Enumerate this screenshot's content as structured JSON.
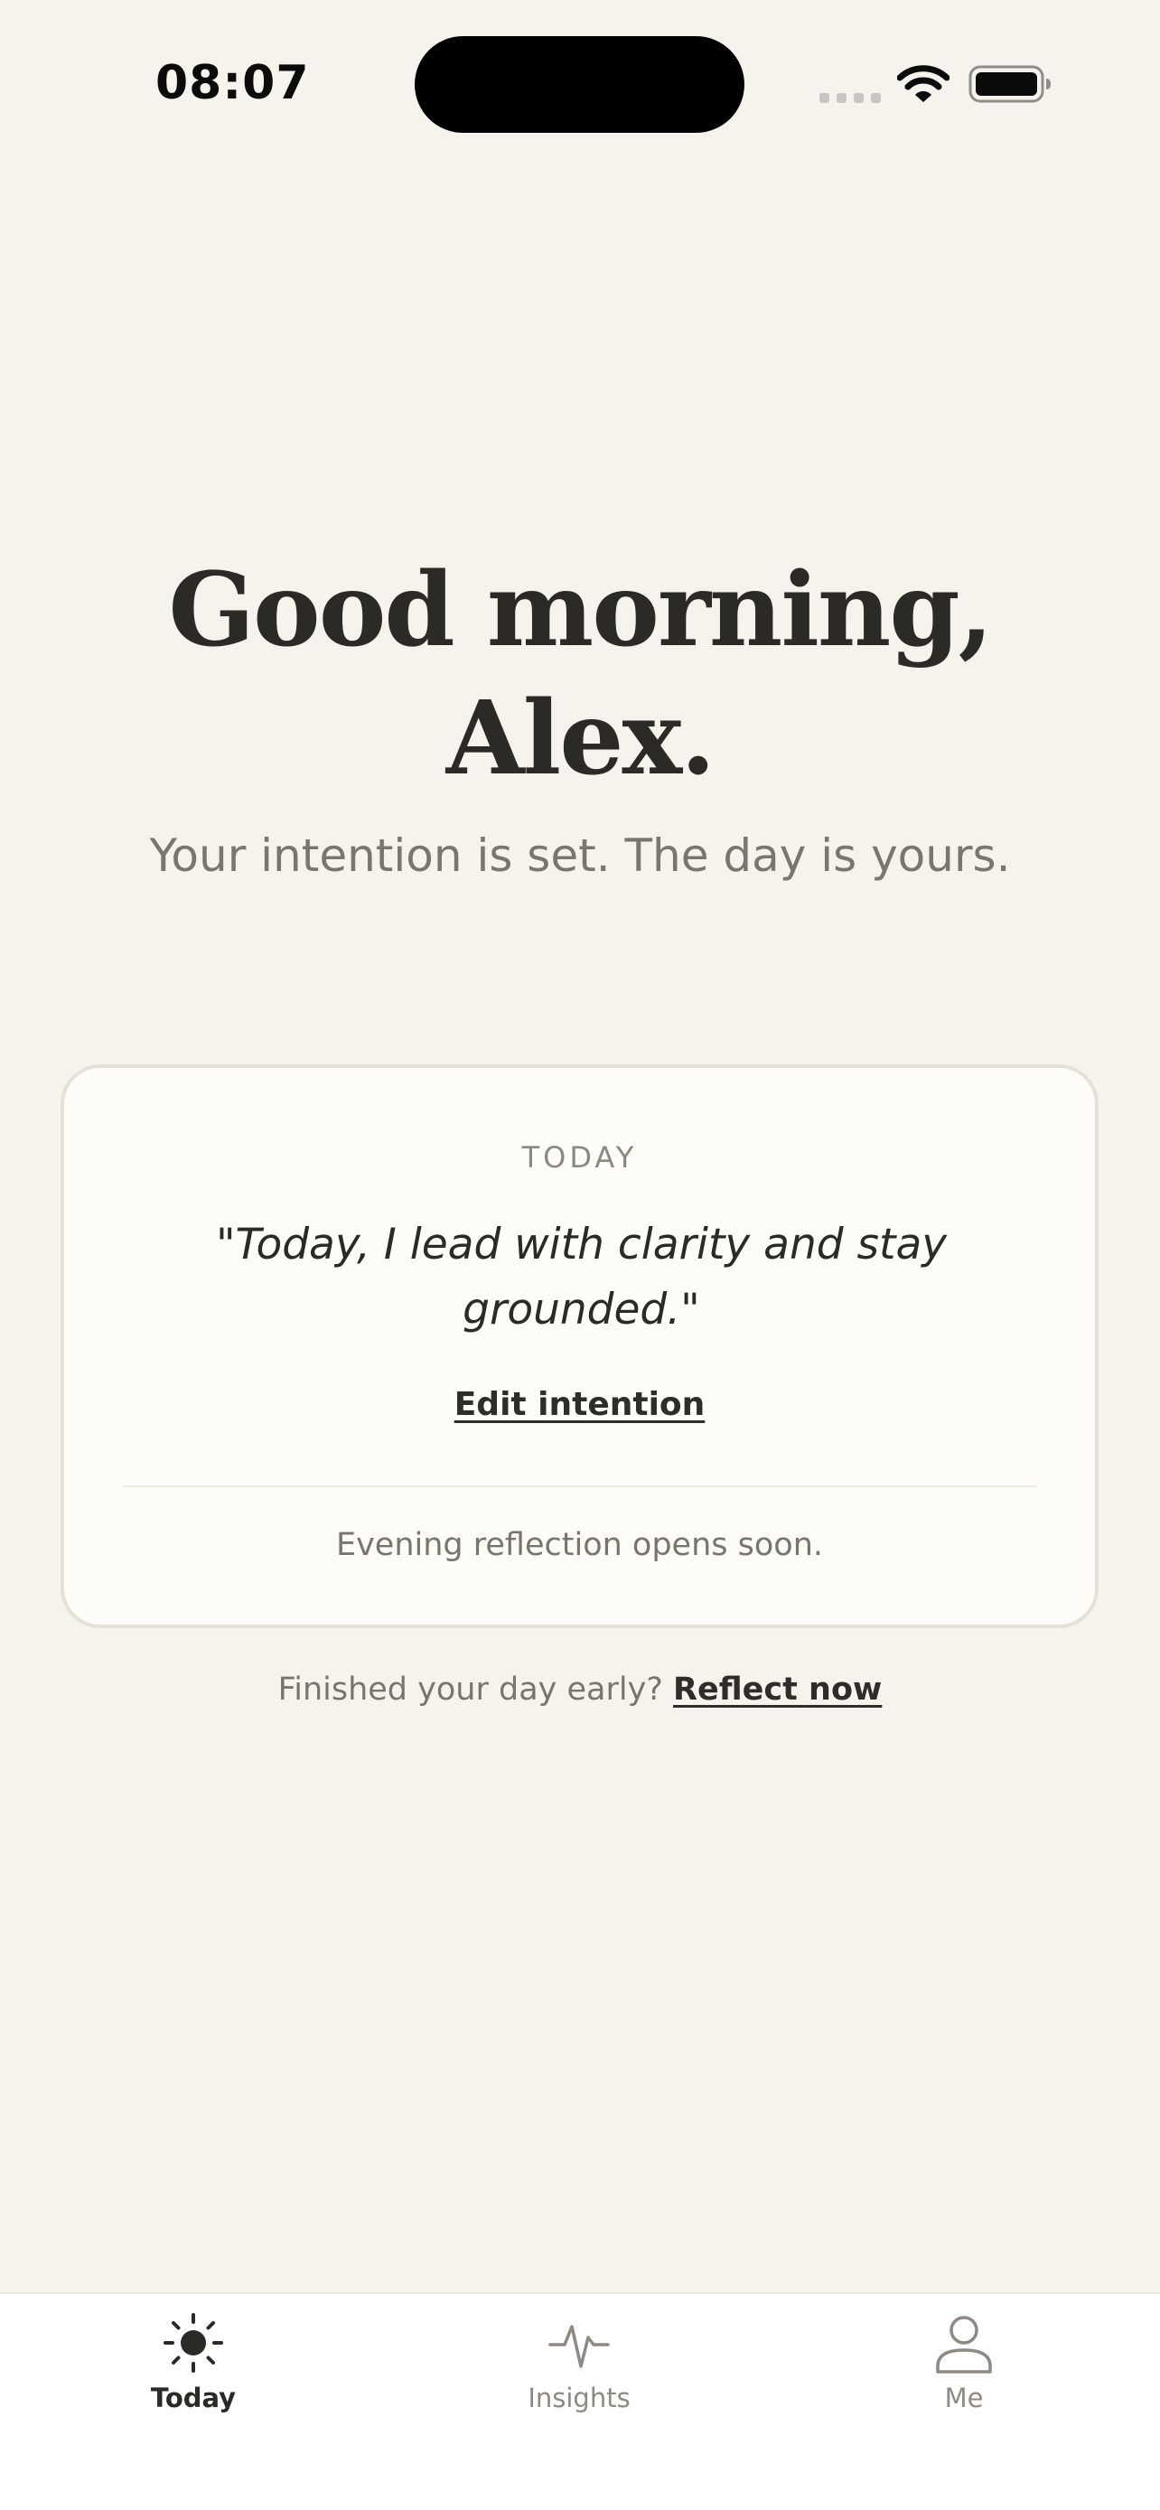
{
  "status_bar": {
    "time": "08:07"
  },
  "greeting": {
    "line1": "Good morning,",
    "line2": "Alex.",
    "subtitle": "Your intention is set. The day is yours."
  },
  "intention_card": {
    "label": "TODAY",
    "quote": "\"Today, I lead with clarity and stay grounded.\"",
    "edit_label": "Edit intention",
    "note": "Evening reflection opens soon."
  },
  "reflect_prompt": {
    "text": "Finished your day early?",
    "link_label": "Reflect now"
  },
  "tab_bar": {
    "tabs": [
      {
        "label": "Today",
        "icon": "sun-icon",
        "active": true
      },
      {
        "label": "Insights",
        "icon": "pulse-icon",
        "active": false
      },
      {
        "label": "Me",
        "icon": "person-icon",
        "active": false
      }
    ]
  },
  "colors": {
    "background": "#f6f3ed",
    "card_background": "#fdfcf9",
    "card_border": "#e6e1d6",
    "text_primary": "#2b2a26",
    "text_muted": "#7a766e",
    "tab_inactive": "#8e8a83"
  }
}
